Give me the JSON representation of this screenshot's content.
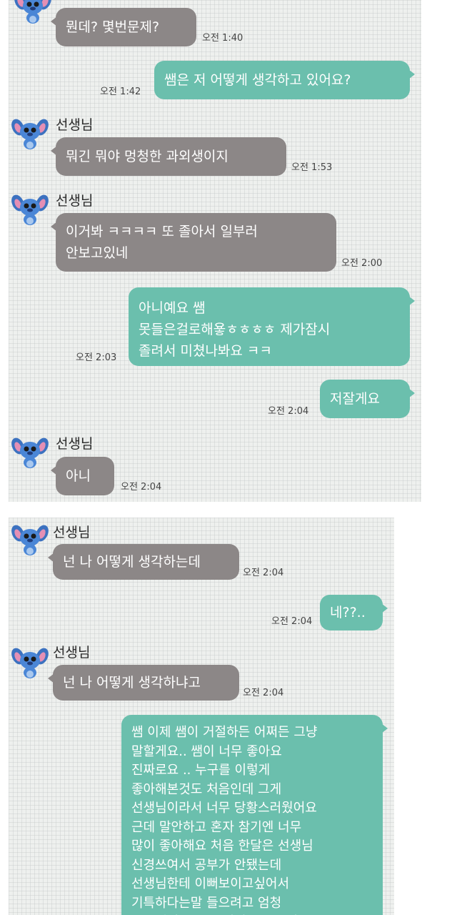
{
  "chat": {
    "panel1": {
      "m1": {
        "text": "뭔데? 몇번문제?",
        "time": "오전 1:40"
      },
      "m2": {
        "text": "쌤은 저 어떻게 생각하고 있어요?",
        "time": "오전 1:42"
      },
      "m3": {
        "sender": "선생님",
        "text": "뭐긴 뭐야 멍청한 과외생이지",
        "time": "오전 1:53"
      },
      "m4": {
        "sender": "선생님",
        "text": "이거봐 ㅋㅋㅋㅋ 또 졸아서 일부러\n안보고있네",
        "time": "오전 2:00"
      },
      "m5": {
        "text": "아니예요 쌤\n못들은걸로해욯ㅎㅎㅎㅎ 제가잠시\n졸려서 미쳤나봐요 ㅋㅋ",
        "time": "오전 2:03"
      },
      "m6": {
        "text": "저잘게요",
        "time": "오전 2:04"
      },
      "m7": {
        "sender": "선생님",
        "text": "아니",
        "time": "오전 2:04"
      }
    },
    "panel2": {
      "m8": {
        "sender": "선생님",
        "text": "넌 나 어떻게 생각하는데",
        "time": "오전 2:04"
      },
      "m9": {
        "text": "네??..",
        "time": "오전 2:04"
      },
      "m10": {
        "sender": "선생님",
        "text": "넌 나 어떻게 생각하냐고",
        "time": "오전 2:04"
      },
      "m11": {
        "text": "쌤 이제 쌤이 거절하든 어쩌든 그냥\n말할게요.. 쌤이 너무 좋아요\n진짜로요 .. 누구를 이렇게\n좋아해본것도 처음인데 그게\n선생님이라서 너무 당황스러웠어요\n근데 말안하고 혼자 참기엔 너무\n많이 좋아해요  처음 한달은 선생님\n신경쓰여서 공부가 안됐는데\n선생님한테 이뻐보이고싶어서\n기특하다는말 들으려고 엄청\n공부해서 등급 올렸어요 .. 그러고"
      }
    }
  },
  "colors": {
    "received_bubble": "#8c8787",
    "sent_bubble": "#6bbfad",
    "background": "#eef0ee"
  },
  "icons": {
    "avatar": "stitch-avatar-icon"
  }
}
